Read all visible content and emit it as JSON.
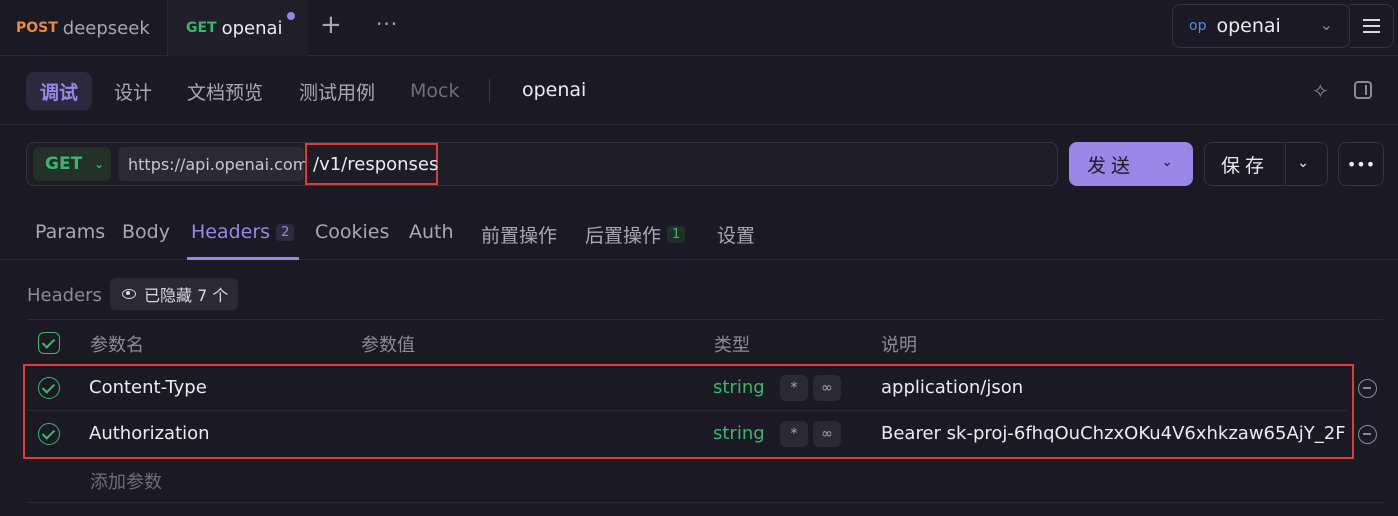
{
  "top_tabs": [
    {
      "method": "POST",
      "name": "deepseek"
    },
    {
      "method": "GET",
      "name": "openai"
    }
  ],
  "environment": {
    "badge": "op",
    "name": "openai"
  },
  "sub_tabs": [
    "调试",
    "设计",
    "文档预览",
    "测试用例",
    "Mock"
  ],
  "api_title": "openai",
  "request": {
    "method": "GET",
    "base_url": "https://api.openai.com",
    "path": "/v1/responses",
    "send_label": "发送",
    "save_label": "保存"
  },
  "request_tabs": [
    {
      "label": "Params"
    },
    {
      "label": "Body"
    },
    {
      "label": "Headers",
      "count": "2"
    },
    {
      "label": "Cookies"
    },
    {
      "label": "Auth"
    },
    {
      "label": "前置操作"
    },
    {
      "label": "后置操作",
      "count": "1"
    },
    {
      "label": "设置"
    }
  ],
  "headers_section": {
    "label": "Headers",
    "hidden_label": "已隐藏 7 个",
    "columns": [
      "参数名",
      "参数值",
      "类型",
      "说明"
    ],
    "rows": [
      {
        "name": "Content-Type",
        "value": "",
        "type": "string",
        "description": "application/json"
      },
      {
        "name": "Authorization",
        "value": "",
        "type": "string",
        "description": "Bearer sk-proj-6fhqOuChzxOKu4V6xhkzaw65AjY_2F"
      }
    ],
    "add_label": "添加参数"
  },
  "colors": {
    "accent": "#9a86e6",
    "green": "#3bb76e",
    "post": "#e98a3f",
    "highlight": "#e03b3b"
  }
}
